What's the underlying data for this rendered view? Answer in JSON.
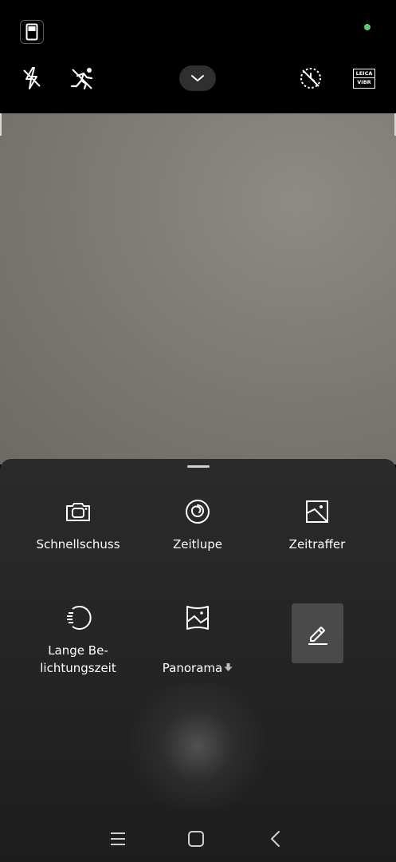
{
  "topbar": {
    "icons": [
      "aspect-ratio-icon",
      "flash-off-icon",
      "motion-off-icon",
      "chevron-down-icon",
      "timer-off-icon"
    ],
    "leica": {
      "line1": "LEICA",
      "line2": "VIBR"
    },
    "status_dot_color": "#55d16b"
  },
  "modes": [
    {
      "label": "Schnellschuss",
      "icon": "quick-shot-icon"
    },
    {
      "label": "Zeitlupe",
      "icon": "slow-motion-icon"
    },
    {
      "label": "Zeitraffer",
      "icon": "time-lapse-icon"
    },
    {
      "label": "Lange Be-\nlichtungszeit",
      "icon": "long-exposure-icon"
    },
    {
      "label": "Panorama",
      "icon": "panorama-icon",
      "badge_icon": "download-arrow-icon"
    }
  ],
  "edit": {
    "icon": "edit-pencil-icon"
  },
  "navbar": {
    "icons": [
      "recents-icon",
      "home-icon",
      "back-icon"
    ]
  }
}
